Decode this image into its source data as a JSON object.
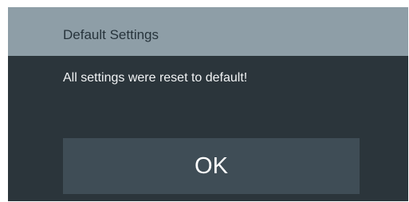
{
  "dialog": {
    "title": "Default Settings",
    "message": "All settings were reset to default!",
    "ok_label": "OK"
  },
  "colors": {
    "header_background": "#8e9ea7",
    "dialog_background": "#2b353b",
    "button_background": "#3f4d56",
    "title_text": "#27343c",
    "body_text": "#f2f4f5"
  }
}
